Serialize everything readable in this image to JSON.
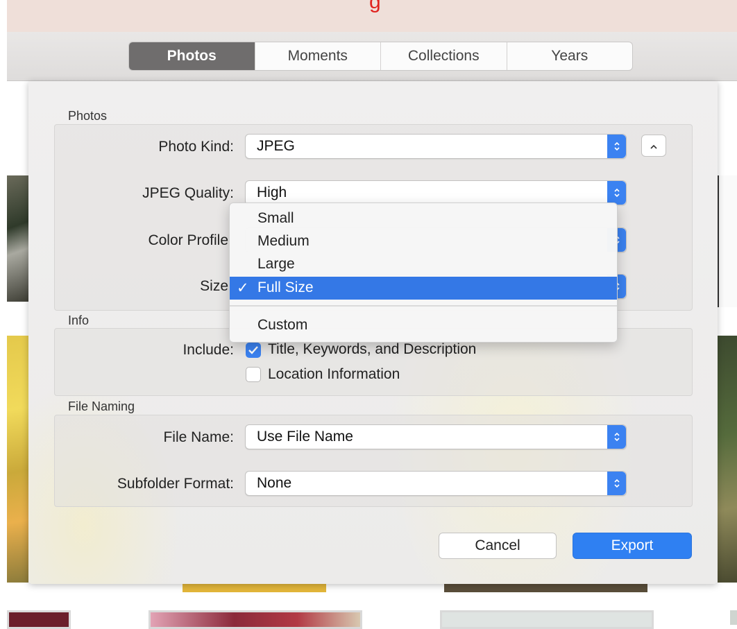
{
  "colors": {
    "accent": "#3b82f1",
    "export_button": "#2f80f2",
    "selected_item": "#3478e6",
    "active_tab": "#6f6d6d"
  },
  "tabs": [
    {
      "label": "Photos",
      "active": true
    },
    {
      "label": "Moments",
      "active": false
    },
    {
      "label": "Collections",
      "active": false
    },
    {
      "label": "Years",
      "active": false
    }
  ],
  "dialog": {
    "photos_section": {
      "title": "Photos",
      "photo_kind_label": "Photo Kind:",
      "photo_kind_value": "JPEG",
      "jpeg_quality_label": "JPEG Quality:",
      "jpeg_quality_value": "High",
      "color_profile_label": "Color Profile",
      "size_label": "Size",
      "collapse_icon": "chevron-up-icon"
    },
    "info_section": {
      "title": "Info",
      "include_label": "Include:",
      "options": [
        {
          "label": "Title, Keywords, and Description",
          "checked": true
        },
        {
          "label": "Location Information",
          "checked": false
        }
      ]
    },
    "naming_section": {
      "title": "File Naming",
      "file_name_label": "File Name:",
      "file_name_value": "Use File Name",
      "subfolder_label": "Subfolder Format:",
      "subfolder_value": "None"
    },
    "buttons": {
      "cancel": "Cancel",
      "export": "Export"
    }
  },
  "size_menu": {
    "items": [
      "Small",
      "Medium",
      "Large",
      "Full Size",
      "Custom"
    ],
    "selected": "Full Size",
    "check_glyph": "✓"
  }
}
